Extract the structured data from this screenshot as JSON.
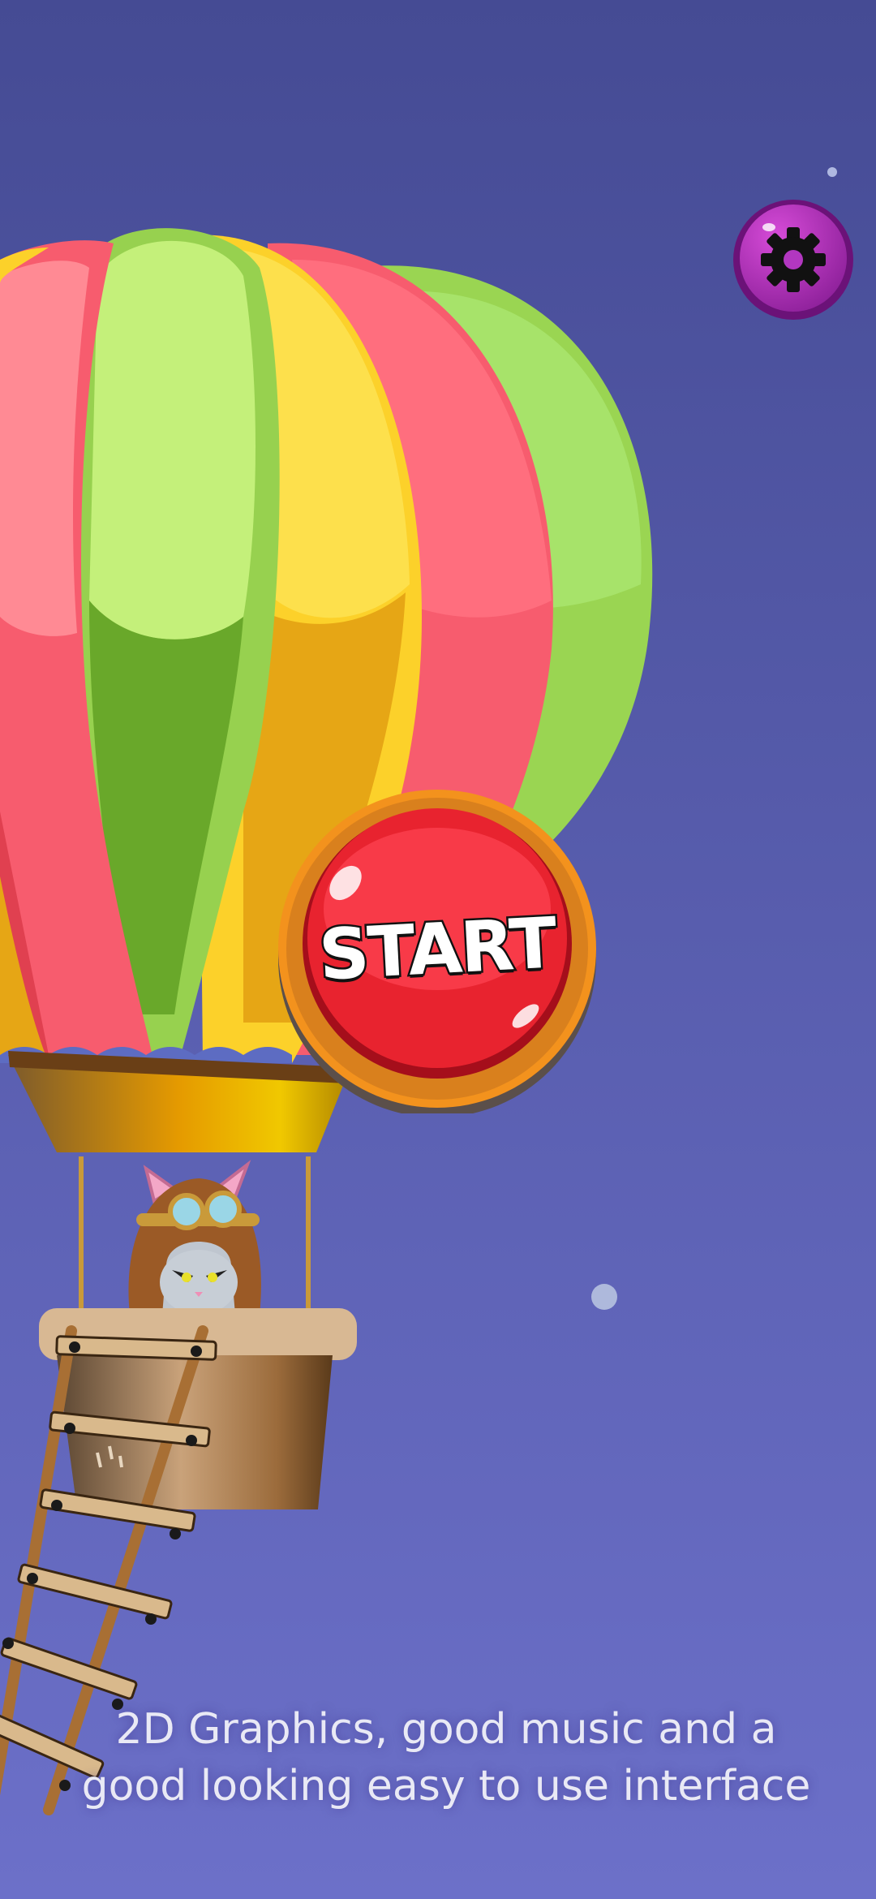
{
  "screen": {
    "background_top": "#454b94",
    "background_bottom": "#6c70c9"
  },
  "settings": {
    "icon": "gear-icon",
    "color": "#9a2aa8"
  },
  "start_button": {
    "label": "START",
    "ring_color": "#f3921d",
    "face_color": "#e8232f"
  },
  "character": {
    "description_icon": "cat-pilot-icon"
  },
  "promo": {
    "line1": "2D Graphics, good music and a",
    "line2": "good looking easy to use interface"
  }
}
